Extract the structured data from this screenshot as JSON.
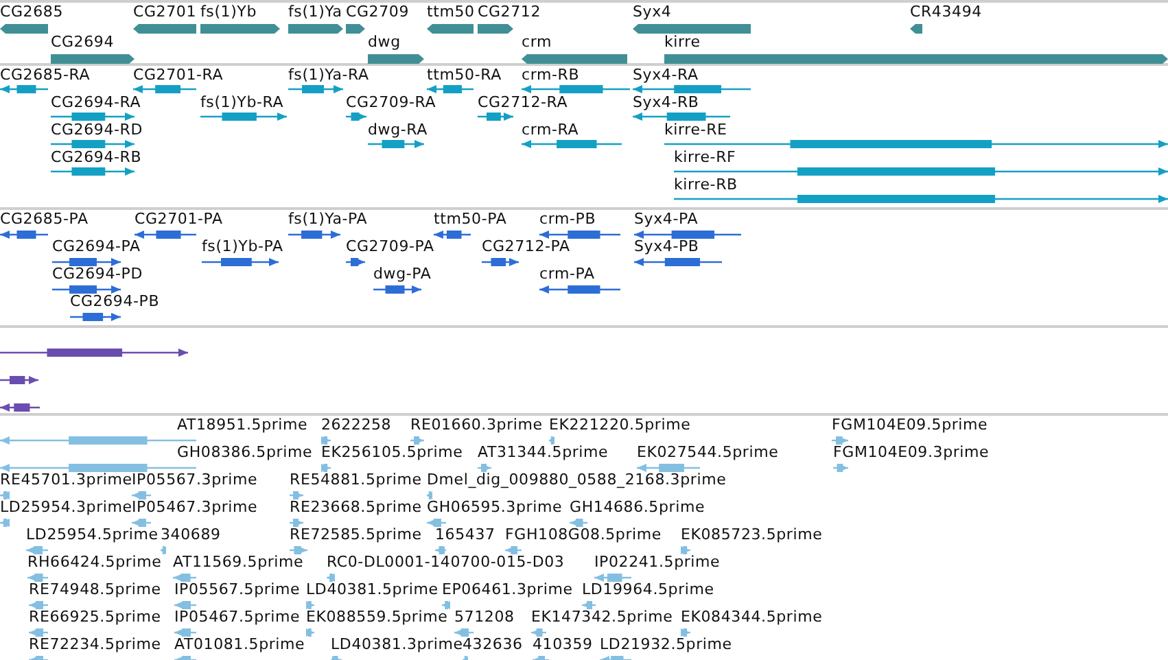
{
  "tracks": [
    {
      "kind": "gene",
      "color": "#418f96",
      "features": [
        {
          "label": "CG2685",
          "reverse": true
        },
        {
          "label": "CG2701",
          "reverse": true
        },
        {
          "label": "fs(1)Yb",
          "reverse": false
        },
        {
          "label": "fs(1)Ya",
          "reverse": false
        },
        {
          "label": "CG2709",
          "reverse": false
        },
        {
          "label": "ttm50",
          "reverse": true
        },
        {
          "label": "CG2712",
          "reverse": false
        },
        {
          "label": "Syx4",
          "reverse": true
        },
        {
          "label": "CR43494",
          "reverse": true
        },
        {
          "label": "CG2694",
          "reverse": false
        },
        {
          "label": "dwg",
          "reverse": false
        },
        {
          "label": "crm",
          "reverse": true
        },
        {
          "label": "kirre",
          "reverse": false
        }
      ]
    },
    {
      "kind": "transcript",
      "color": "#14a0c4",
      "features": [
        {
          "label": "CG2685-RA",
          "reverse": true
        },
        {
          "label": "CG2701-RA",
          "reverse": true
        },
        {
          "label": "fs(1)Ya-RA",
          "reverse": false
        },
        {
          "label": "ttm50-RA",
          "reverse": true
        },
        {
          "label": "crm-RB",
          "reverse": true
        },
        {
          "label": "Syx4-RA",
          "reverse": true
        },
        {
          "label": "CG2694-RA",
          "reverse": false
        },
        {
          "label": "fs(1)Yb-RA",
          "reverse": false
        },
        {
          "label": "CG2709-RA",
          "reverse": false
        },
        {
          "label": "CG2712-RA",
          "reverse": false
        },
        {
          "label": "Syx4-RB",
          "reverse": true
        },
        {
          "label": "CG2694-RD",
          "reverse": false
        },
        {
          "label": "dwg-RA",
          "reverse": false
        },
        {
          "label": "crm-RA",
          "reverse": true
        },
        {
          "label": "kirre-RE",
          "reverse": false
        },
        {
          "label": "CG2694-RB",
          "reverse": false
        },
        {
          "label": "kirre-RF",
          "reverse": false
        },
        {
          "label": "kirre-RB",
          "reverse": false
        }
      ]
    },
    {
      "kind": "transcript",
      "color": "#2d6dd6",
      "features": [
        {
          "label": "CG2685-PA",
          "reverse": true
        },
        {
          "label": "CG2701-PA",
          "reverse": true
        },
        {
          "label": "fs(1)Ya-PA",
          "reverse": false
        },
        {
          "label": "ttm50-PA",
          "reverse": true
        },
        {
          "label": "crm-PB",
          "reverse": true
        },
        {
          "label": "Syx4-PA",
          "reverse": true
        },
        {
          "label": "CG2694-PA",
          "reverse": false
        },
        {
          "label": "fs(1)Yb-PA",
          "reverse": false
        },
        {
          "label": "CG2709-PA",
          "reverse": false
        },
        {
          "label": "CG2712-PA",
          "reverse": false
        },
        {
          "label": "Syx4-PB",
          "reverse": true
        },
        {
          "label": "CG2694-PD",
          "reverse": false
        },
        {
          "label": "dwg-PA",
          "reverse": false
        },
        {
          "label": "crm-PA",
          "reverse": true
        },
        {
          "label": "CG2694-PB",
          "reverse": false
        }
      ]
    },
    {
      "kind": "transcript",
      "color": "#6a4db0",
      "features": [
        {
          "reverse": false
        },
        {
          "reverse": false
        },
        {
          "reverse": true
        }
      ]
    },
    {
      "kind": "transcript",
      "color": "#84bfe2",
      "features": [
        {
          "label": "AT18951.5prime",
          "reverse": true
        },
        {
          "label": "2622258",
          "reverse": false
        },
        {
          "label": "RE01660.3prime",
          "reverse": false
        },
        {
          "label": "EK221220.5prime",
          "reverse": true
        },
        {
          "label": "FGM104E09.5prime",
          "reverse": false
        },
        {
          "label": "GH08386.5prime",
          "reverse": true
        },
        {
          "label": "EK256105.5prime",
          "reverse": false
        },
        {
          "label": "AT31344.5prime",
          "reverse": false
        },
        {
          "label": "EK027544.5prime",
          "reverse": true
        },
        {
          "label": "FGM104E09.3prime",
          "reverse": false
        },
        {
          "label": "RE45701.3prime",
          "reverse": true
        },
        {
          "label": "IP05567.3prime",
          "reverse": true
        },
        {
          "label": "RE54881.5prime",
          "reverse": false
        },
        {
          "label": "Dmel_dig_009880_0588_2168.3prime",
          "reverse": true
        },
        {
          "label": "LD25954.3prime",
          "reverse": true
        },
        {
          "label": "IP05467.3prime",
          "reverse": true
        },
        {
          "label": "RE23668.5prime",
          "reverse": false
        },
        {
          "label": "GH06595.3prime",
          "reverse": true
        },
        {
          "label": "GH14686.5prime",
          "reverse": true
        },
        {
          "label": "LD25954.5prime",
          "reverse": true
        },
        {
          "label": "340689",
          "reverse": true
        },
        {
          "label": "RE72585.5prime",
          "reverse": false
        },
        {
          "label": "165437",
          "reverse": true
        },
        {
          "label": "FGH108G08.5prime",
          "reverse": true
        },
        {
          "label": "EK085723.5prime",
          "reverse": false
        },
        {
          "label": "RH66424.5prime",
          "reverse": true
        },
        {
          "label": "AT11569.5prime",
          "reverse": true
        },
        {
          "label": "RC0-DL0001-140700-015-D03",
          "reverse": true
        },
        {
          "label": "IP02241.5prime",
          "reverse": true
        },
        {
          "label": "RE74948.5prime",
          "reverse": true
        },
        {
          "label": "IP05567.5prime",
          "reverse": true
        },
        {
          "label": "LD40381.5prime",
          "reverse": false
        },
        {
          "label": "EP06461.3prime",
          "reverse": true
        },
        {
          "label": "LD19964.5prime",
          "reverse": true
        },
        {
          "label": "RE66925.5prime",
          "reverse": true
        },
        {
          "label": "IP05467.5prime",
          "reverse": true
        },
        {
          "label": "EK088559.5prime",
          "reverse": false
        },
        {
          "label": "571208",
          "reverse": true
        },
        {
          "label": "EK147342.5prime",
          "reverse": true
        },
        {
          "label": "EK084344.5prime",
          "reverse": false
        },
        {
          "label": "RE72234.5prime",
          "reverse": true
        },
        {
          "label": "AT01081.5prime",
          "reverse": true
        },
        {
          "label": "LD40381.3prime",
          "reverse": false
        },
        {
          "label": "432636",
          "reverse": true
        },
        {
          "label": "410359",
          "reverse": true
        },
        {
          "label": "LD21932.5prime",
          "reverse": true
        }
      ]
    }
  ]
}
